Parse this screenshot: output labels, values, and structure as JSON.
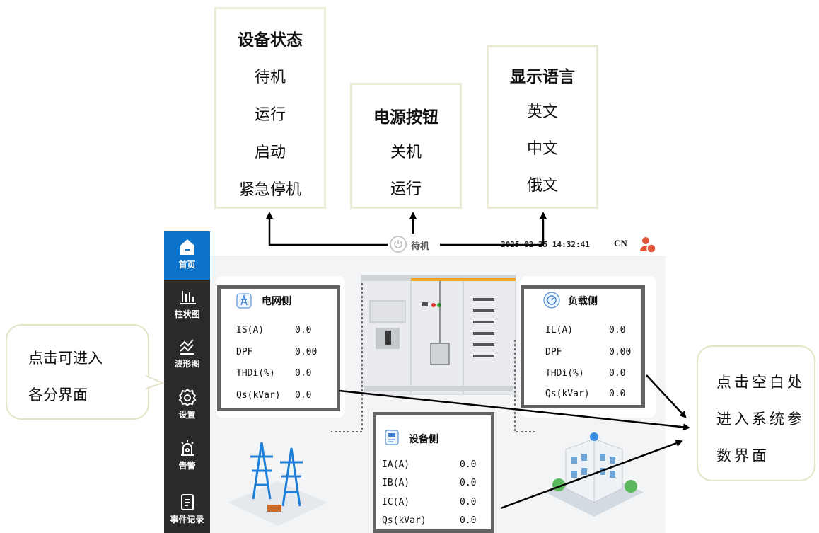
{
  "annotations": {
    "device_status": {
      "title": "设备状态",
      "options": [
        "待机",
        "运行",
        "启动",
        "紧急停机"
      ]
    },
    "power_button": {
      "title": "电源按钮",
      "options": [
        "关机",
        "运行"
      ]
    },
    "display_language": {
      "title": "显示语言",
      "options": [
        "英文",
        "中文",
        "俄文"
      ]
    },
    "left_bubble": {
      "line1": "点击可进入",
      "line2": "各分界面"
    },
    "right_bubble": {
      "line1": "点击空白处",
      "line2": "进入系统参",
      "line3": "数界面"
    }
  },
  "sidebar": {
    "items": [
      {
        "label": "首页",
        "icon": "home-icon"
      },
      {
        "label": "柱状图",
        "icon": "bar-chart-icon"
      },
      {
        "label": "波形图",
        "icon": "waveform-icon"
      },
      {
        "label": "设置",
        "icon": "gear-icon"
      },
      {
        "label": "告警",
        "icon": "alarm-icon"
      },
      {
        "label": "事件记录",
        "icon": "event-log-icon"
      }
    ],
    "active_color": "#0b73c9"
  },
  "topbar": {
    "status": "待机",
    "datetime": "2025-02-25 14:32:41",
    "language": "CN"
  },
  "grid_side": {
    "title": "电网侧",
    "rows": [
      {
        "key": "IS(A)",
        "value": "0.0"
      },
      {
        "key": "DPF",
        "value": "0.00"
      },
      {
        "key": "THDi(%)",
        "value": "0.0"
      },
      {
        "key": "Qs(kVar)",
        "value": "0.0"
      }
    ]
  },
  "load_side": {
    "title": "负载侧",
    "rows": [
      {
        "key": "IL(A)",
        "value": "0.0"
      },
      {
        "key": "DPF",
        "value": "0.00"
      },
      {
        "key": "THDi(%)",
        "value": "0.0"
      },
      {
        "key": "Qs(kVar)",
        "value": "0.0"
      }
    ]
  },
  "device_side": {
    "title": "设备侧",
    "rows": [
      {
        "key": "IA(A)",
        "value": "0.0"
      },
      {
        "key": "IB(A)",
        "value": "0.0"
      },
      {
        "key": "IC(A)",
        "value": "0.0"
      },
      {
        "key": "Qs(kVar)",
        "value": "0.0"
      }
    ]
  }
}
